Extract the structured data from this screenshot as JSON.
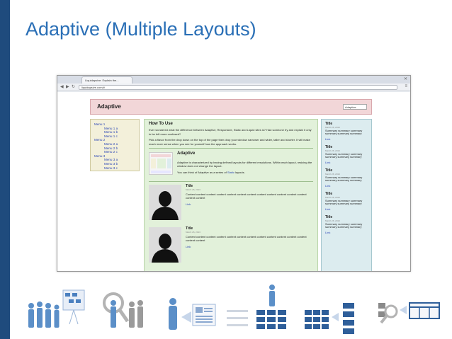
{
  "slide": {
    "title": "Adaptive (Multiple Layouts)",
    "accent": "#1f4b7d",
    "title_color": "#2a6fb6"
  },
  "browser": {
    "tab_title": "Liquidapsive: Explain the...",
    "address": "liquidapsive.com/#",
    "nav_icons": [
      "back-icon",
      "forward-icon",
      "reload-icon"
    ]
  },
  "site": {
    "header_title": "Adaptive",
    "layout_select": "Adaptive",
    "menu": [
      {
        "label": "Menu 1",
        "sub": false
      },
      {
        "label": "Menu 1 a",
        "sub": true
      },
      {
        "label": "Menu 1 b",
        "sub": true
      },
      {
        "label": "Menu 1 c",
        "sub": true
      },
      {
        "label": "Menu 2",
        "sub": false
      },
      {
        "label": "Menu 2 a",
        "sub": true
      },
      {
        "label": "Menu 2 b",
        "sub": true
      },
      {
        "label": "Menu 2 c",
        "sub": true
      },
      {
        "label": "Menu 3",
        "sub": false
      },
      {
        "label": "Menu 3 a",
        "sub": true
      },
      {
        "label": "Menu 3 b",
        "sub": true
      },
      {
        "label": "Menu 3 c",
        "sub": true
      }
    ],
    "how_to_use": {
      "title": "How To Use",
      "p1": "Ever wondered what the difference between Adaptive, Responsive, Static and Liquid sites is? Had someone try and explain it only to be left more confused?",
      "p2": "Pick a flavor from the drop down on the top of the page then drop your window narrower and wider, taller and shorter. It will make much more sense when you see for yourself how the approach works."
    },
    "adaptive": {
      "title": "Adaptive",
      "text": "Adaptive is characterized by having defined layouts for different resolutions. Within each layout, resizing the window does not change the layout.",
      "text2": "You can think of Adaptive as a series of",
      "link": "Static",
      "text3": "layouts."
    },
    "posts": [
      {
        "title": "Title",
        "date": "March 26, 2013",
        "body": "Content content content content content content content content content content content content content content",
        "link": "Link"
      },
      {
        "title": "Title",
        "date": "March 26, 2013",
        "body": "Content content content content content content content content content content content content content content",
        "link": "Link"
      }
    ],
    "sidebar": [
      {
        "title": "Title",
        "date": "March 26, 2013",
        "body": "Summary summary summary summary summary summary",
        "link": "Link"
      },
      {
        "title": "Title",
        "date": "March 26, 2013",
        "body": "Summary summary summary summary summary summary",
        "link": "Link"
      },
      {
        "title": "Title",
        "date": "March 26, 2013",
        "body": "Summary summary summary summary summary summary",
        "link": "Link"
      },
      {
        "title": "Title",
        "date": "March 26, 2013",
        "body": "Summary summary summary summary summary summary",
        "link": "Link"
      },
      {
        "title": "Title",
        "date": "March 26, 2013",
        "body": "Summary summary summary summary summary summary",
        "link": "Link"
      }
    ]
  },
  "footer_icons": [
    "people-presentation-icon",
    "people-search-icon",
    "person-document-icon",
    "person-layers-icon",
    "grid-flow-icon",
    "search-layout-icon"
  ]
}
